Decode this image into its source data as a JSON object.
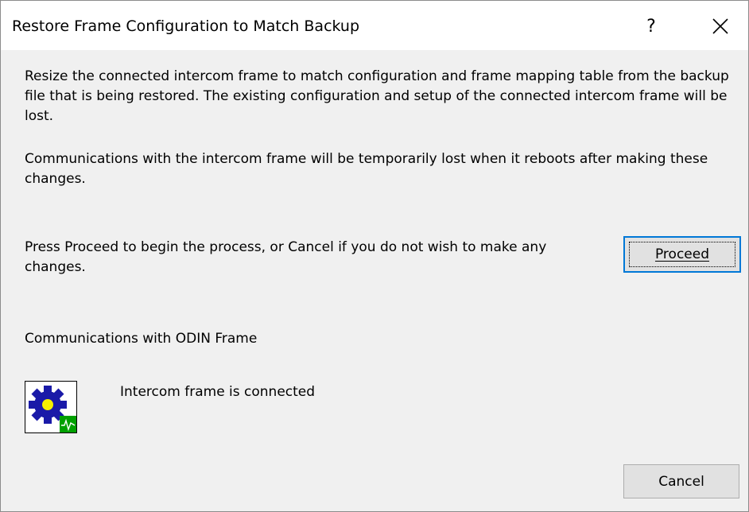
{
  "window": {
    "title": "Restore Frame Configuration to Match Backup",
    "help_glyph": "?",
    "close_icon": "close-icon"
  },
  "body": {
    "para1": "Resize the connected intercom frame to match configuration and frame mapping table from the backup file that is being restored. The existing configuration and setup of the connected intercom frame will be lost.",
    "para2": "Communications with the intercom frame will be temporarily lost when it reboots after making these changes.",
    "para3": "Press Proceed to begin the process, or Cancel if you do not wish to make any changes.",
    "proceed_label": "Proceed",
    "comm_label": "Communications with ODIN Frame",
    "status_text": "Intercom frame is connected",
    "status_icon": "gear-connected-icon",
    "cancel_label": "Cancel"
  },
  "colors": {
    "gear": "#1a1aa8",
    "gear_center": "#f5f000",
    "status_green": "#00a000",
    "focus_border": "#0078d7"
  }
}
